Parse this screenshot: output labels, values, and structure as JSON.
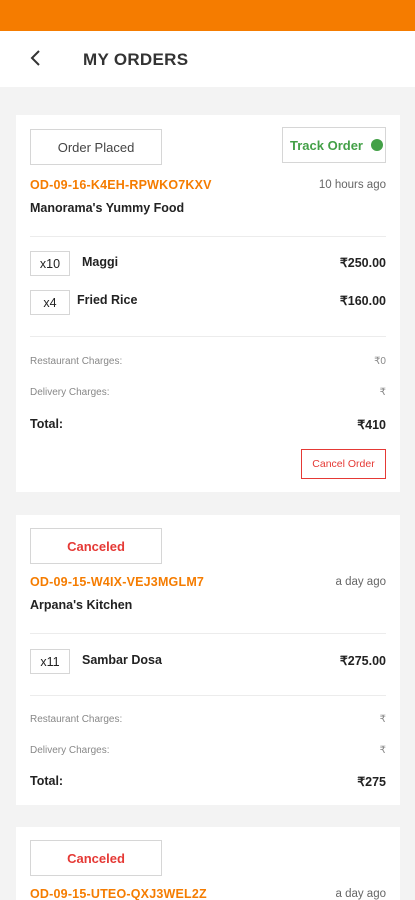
{
  "header": {
    "title": "MY ORDERS",
    "back_icon": "chevron-left-icon"
  },
  "colors": {
    "status_bar": "#f57c00",
    "accent": "#f57c00",
    "track_green": "#43a047",
    "cancel_red": "#e53935"
  },
  "orders": [
    {
      "status": "Order Placed",
      "track_label": "Track Order",
      "order_id": "OD-09-16-K4EH-RPWKO7KXV",
      "time_ago": "10 hours ago",
      "restaurant": "Manorama's Yummy Food",
      "items": [
        {
          "qty": "x10",
          "name": "Maggi",
          "price": "₹250.00"
        },
        {
          "qty": "x4",
          "name": "Fried Rice",
          "price": "₹160.00"
        }
      ],
      "restaurant_charges_label": "Restaurant Charges:",
      "restaurant_charges_value": "₹0",
      "delivery_charges_label": "Delivery Charges:",
      "delivery_charges_value": "₹",
      "total_label": "Total:",
      "total_value": "₹410",
      "cancel_label": "Cancel Order"
    },
    {
      "status": "Canceled",
      "order_id": "OD-09-15-W4IX-VEJ3MGLM7",
      "time_ago": "a day ago",
      "restaurant": "Arpana's Kitchen",
      "items": [
        {
          "qty": "x11",
          "name": "Sambar Dosa",
          "price": "₹275.00"
        }
      ],
      "restaurant_charges_label": "Restaurant Charges:",
      "restaurant_charges_value": "₹",
      "delivery_charges_label": "Delivery Charges:",
      "delivery_charges_value": "₹",
      "total_label": "Total:",
      "total_value": "₹275"
    },
    {
      "status": "Canceled",
      "order_id": "OD-09-15-UTEO-QXJ3WEL2Z",
      "time_ago": "a day ago"
    }
  ]
}
